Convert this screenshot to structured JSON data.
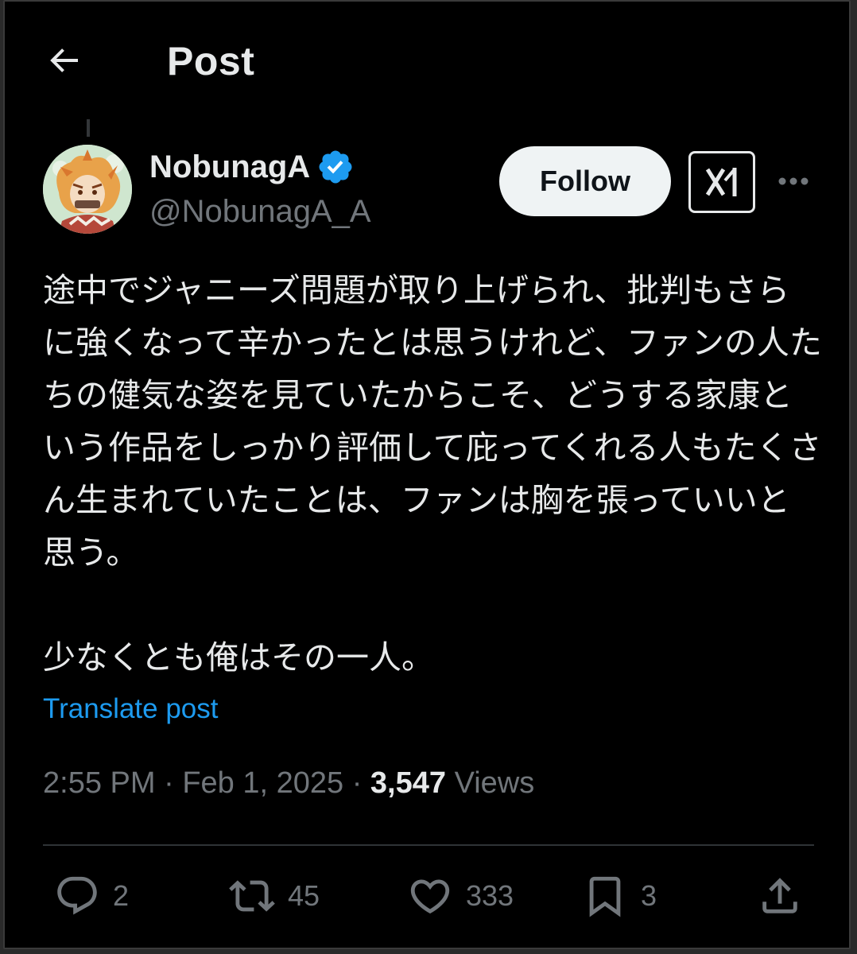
{
  "header": {
    "title": "Post"
  },
  "author": {
    "display_name": "NobunagA",
    "handle": "@NobunagA_A",
    "verified": true
  },
  "buttons": {
    "follow_label": "Follow"
  },
  "post": {
    "text": "途中でジャニーズ問題が取り上げられ、批判もさらに強くなって辛かったとは思うけれど、ファンの人たちの健気な姿を見ていたからこそ、どうする家康という作品をしっかり評価して庇ってくれる人もたくさん生まれていたことは、ファンは胸を張っていいと思う。\n\n少なくとも俺はその一人。",
    "translate_label": "Translate post"
  },
  "meta": {
    "time": "2:55 PM",
    "separator": " · ",
    "date": "Feb 1, 2025",
    "views_count": "3,547",
    "views_label": "Views"
  },
  "actions": {
    "replies": "2",
    "reposts": "45",
    "likes": "333",
    "bookmarks": "3"
  },
  "colors": {
    "background": "#000000",
    "link": "#1d9bf0",
    "verified": "#1d9bf0",
    "muted": "#71767b"
  }
}
